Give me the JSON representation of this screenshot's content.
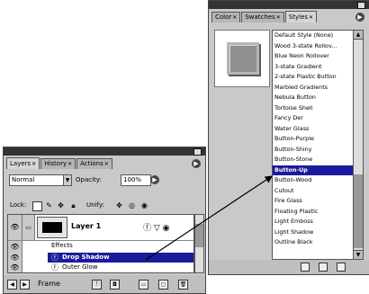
{
  "styles_panel": {
    "tabs": [
      {
        "label": "Color",
        "active": false
      },
      {
        "label": "Swatches",
        "active": false
      },
      {
        "label": "Styles",
        "active": true
      }
    ],
    "items": [
      "Default Style (None)",
      "Wood 3-state Rollov...",
      "Blue Neon Rollover",
      "3-state Gradient",
      "2-state Plastic Button",
      "Marbled Gradients",
      "Nebula Button",
      "Tortoise Shell",
      "Fancy Der",
      "Water Glass",
      "Button-Purple",
      "Button-Shiny",
      "Button-Stone",
      "Button-Up",
      "Button-Wood",
      "Cutout",
      "Fire Glass",
      "Floating Plastic",
      "Light Emboss",
      "Light Shadow",
      "Outline Black"
    ],
    "selected_item": "Button-Up"
  },
  "layers_panel": {
    "tabs": [
      {
        "label": "Layers",
        "active": true
      },
      {
        "label": "History",
        "active": false
      },
      {
        "label": "Actions",
        "active": false
      }
    ],
    "blend_mode": "Normal",
    "opacity_label": "Opacity:",
    "opacity_value": "100%",
    "lock_label": "Lock:",
    "unify_label": "Unify:",
    "layer_name": "Layer 1",
    "effects_label": "Effects",
    "effect_selected": "Drop Shadow",
    "effect_partial": "Outer Glow",
    "footer_label": "Frame"
  },
  "icons": {
    "eye": "eye-icon",
    "brush": "brush-icon",
    "fx": "layer-effects-icon",
    "lock": "lock-icon"
  }
}
